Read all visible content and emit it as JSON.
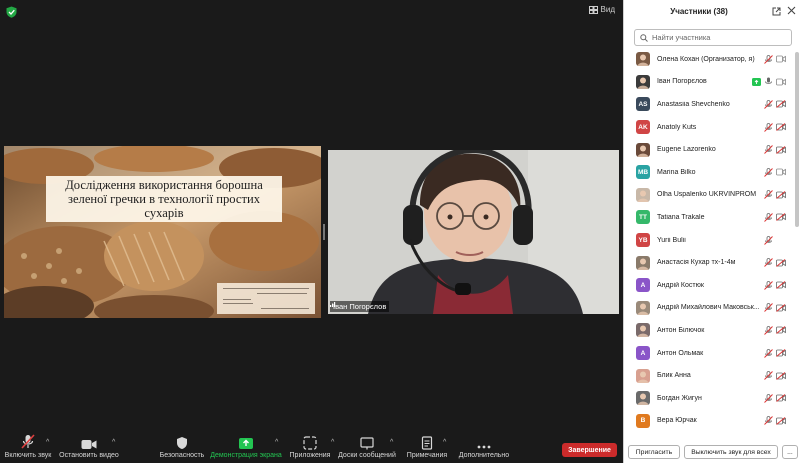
{
  "topbar": {
    "view_label": "Вид"
  },
  "slide": {
    "title": "Дослідження використання борошна зеленої гречки в технології простих сухарів"
  },
  "video": {
    "participant_name": "Іван Погорєлов"
  },
  "toolbar": {
    "items": [
      {
        "label": "Включить звук",
        "icon": "mic-muted-icon"
      },
      {
        "label": "Остановить видео",
        "icon": "video-camera-icon"
      },
      {
        "label": "Безопасность",
        "icon": "security-shield-icon"
      },
      {
        "label": "Демонстрация экрана",
        "icon": "share-screen-icon"
      },
      {
        "label": "Приложения",
        "icon": "apps-icon"
      },
      {
        "label": "Доски сообщений",
        "icon": "whiteboard-icon"
      },
      {
        "label": "Примечания",
        "icon": "notes-icon"
      },
      {
        "label": "Дополнительно",
        "icon": "more-icon"
      }
    ],
    "end_label": "Завершение"
  },
  "panel": {
    "title": "Участники (38)",
    "search_placeholder": "Найти участника",
    "participants": [
      {
        "name": "Олена Кохан (Организатор, я)",
        "initials": "",
        "color": "#7a5a44",
        "photo": true,
        "mic": "muted",
        "video": "gray"
      },
      {
        "name": "Іван Погорєлов",
        "initials": "",
        "color": "#3b3b3b",
        "photo": true,
        "mic": "on",
        "video": "gray",
        "share": true
      },
      {
        "name": "Anastasiia Shevchenko",
        "initials": "AS",
        "color": "#3a4a5c",
        "photo": false,
        "mic": "muted",
        "video": "off"
      },
      {
        "name": "Anatoly Kuts",
        "initials": "AK",
        "color": "#d04545",
        "photo": false,
        "mic": "muted",
        "video": "off"
      },
      {
        "name": "Eugene Lazorenko",
        "initials": "",
        "color": "#6a4a3a",
        "photo": true,
        "mic": "muted",
        "video": "off"
      },
      {
        "name": "Marina Bilko",
        "initials": "MB",
        "color": "#2aa3a3",
        "photo": false,
        "mic": "muted",
        "video": "gray"
      },
      {
        "name": "Olha Uspalenko UKRVINPROM",
        "initials": "",
        "color": "#c8b8a8",
        "photo": true,
        "mic": "muted",
        "video": "off"
      },
      {
        "name": "Tatiana Trakale",
        "initials": "TT",
        "color": "#35b86a",
        "photo": false,
        "mic": "muted",
        "video": "off"
      },
      {
        "name": "Yurii Bulii",
        "initials": "YB",
        "color": "#d04545",
        "photo": false,
        "mic": "muted",
        "video": ""
      },
      {
        "name": "Анастасія Кухар тх-1-4м",
        "initials": "",
        "color": "#8a7a6a",
        "photo": true,
        "mic": "muted",
        "video": "off"
      },
      {
        "name": "Андрій Костюк",
        "initials": "А",
        "color": "#8a55c8",
        "photo": false,
        "mic": "muted",
        "video": "off"
      },
      {
        "name": "Андрій Михайлович Маковськ...",
        "initials": "",
        "color": "#9a8a7a",
        "photo": true,
        "mic": "muted",
        "video": "off"
      },
      {
        "name": "Антон Білючок",
        "initials": "",
        "color": "#7a6a6a",
        "photo": true,
        "mic": "muted",
        "video": "off"
      },
      {
        "name": "Антон Ольмак",
        "initials": "А",
        "color": "#8a55c8",
        "photo": false,
        "mic": "muted",
        "video": "off"
      },
      {
        "name": "Блик Анна",
        "initials": "",
        "color": "#d8a090",
        "photo": true,
        "mic": "muted",
        "video": "off"
      },
      {
        "name": "Богдан Жигун",
        "initials": "",
        "color": "#6a6a6a",
        "photo": true,
        "mic": "muted",
        "video": "off"
      },
      {
        "name": "Вера Юрчак",
        "initials": "В",
        "color": "#e07a1f",
        "photo": false,
        "mic": "muted",
        "video": "off"
      }
    ],
    "invite_label": "Пригласить",
    "mute_all_label": "Выключить звук для всех",
    "more_label": "..."
  }
}
